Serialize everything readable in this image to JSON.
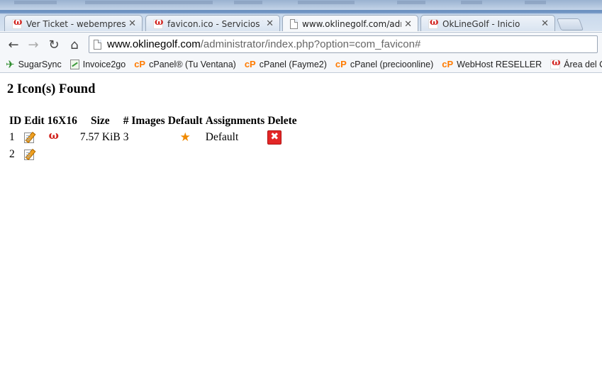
{
  "browser": {
    "tabs": [
      {
        "title": "Ver Ticket - webempresa.c",
        "favicon": "webempresa-favicon",
        "active": false
      },
      {
        "title": "favicon.ico - Servicios Wel",
        "favicon": "webempresa-favicon",
        "active": false
      },
      {
        "title": "www.oklinegolf.com/adm",
        "favicon": "page-icon",
        "active": true
      },
      {
        "title": "OkLineGolf - Inicio",
        "favicon": "webempresa-favicon",
        "active": false
      }
    ],
    "url": {
      "host": "www.oklinegolf.com",
      "path": "/administrator/index.php?option=com_favicon#"
    },
    "bookmarks": [
      {
        "label": "SugarSync",
        "icon": "sugarsync-icon"
      },
      {
        "label": "Invoice2go",
        "icon": "invoice-icon"
      },
      {
        "label": "cPanel® (Tu Ventana)",
        "icon": "cpanel-icon"
      },
      {
        "label": "cPanel (Fayme2)",
        "icon": "cpanel-icon"
      },
      {
        "label": "cPanel (precioonline)",
        "icon": "cpanel-icon"
      },
      {
        "label": "WebHost RESELLER",
        "icon": "cpanel-icon"
      },
      {
        "label": "Área del Cliente",
        "icon": "webempresa-favicon"
      }
    ],
    "cpanel_glyph": "cP"
  },
  "page": {
    "heading": "2 Icon(s) Found",
    "columns": [
      "ID",
      "Edit",
      "16X16",
      "Size",
      "# Images",
      "Default",
      "Assignments",
      "Delete"
    ],
    "rows": [
      {
        "id": "1",
        "size": "7.57 KiB",
        "images": "3",
        "is_default": true,
        "assignments": "Default",
        "has_favicon": true,
        "has_delete": true
      },
      {
        "id": "2",
        "size": "",
        "images": "",
        "is_default": false,
        "assignments": "",
        "has_favicon": false,
        "has_delete": false
      }
    ]
  }
}
